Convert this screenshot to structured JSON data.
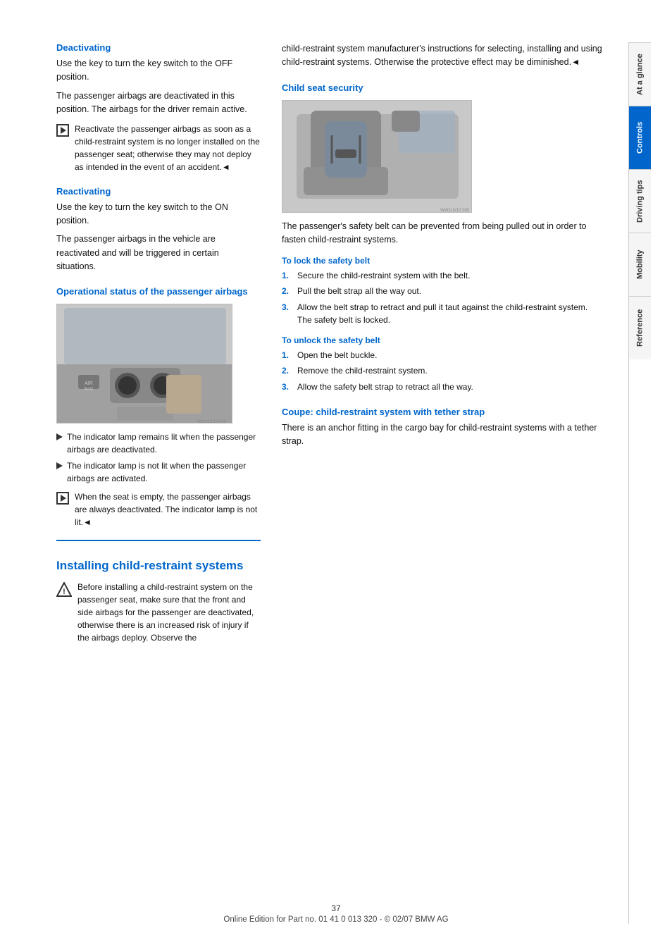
{
  "page": {
    "number": "37",
    "footer": "Online Edition for Part no. 01 41 0 013 320 - © 02/07 BMW AG"
  },
  "sidebar": {
    "tabs": [
      {
        "id": "at-a-glance",
        "label": "At a glance",
        "active": false
      },
      {
        "id": "controls",
        "label": "Controls",
        "active": true
      },
      {
        "id": "driving-tips",
        "label": "Driving tips",
        "active": false
      },
      {
        "id": "mobility",
        "label": "Mobility",
        "active": false
      },
      {
        "id": "reference",
        "label": "Reference",
        "active": false
      }
    ]
  },
  "left_column": {
    "deactivating": {
      "heading": "Deactivating",
      "para1": "Use the key to turn the key switch to the OFF position.",
      "para2": "The passenger airbags are deactivated in this position. The airbags for the driver remain active.",
      "note1": "Reactivate the passenger airbags as soon as a child-restraint system is no longer installed on the passenger seat; otherwise they may not deploy as intended in the event of an accident.◄"
    },
    "reactivating": {
      "heading": "Reactivating",
      "para1": "Use the key to turn the key switch to the ON position.",
      "para2": "The passenger airbags in the vehicle are reactivated and will be triggered in certain situations."
    },
    "operational_status": {
      "heading": "Operational status of the passenger airbags",
      "bullet1": "The indicator lamp remains lit when the passenger airbags are deactivated.",
      "bullet2": "The indicator lamp is not lit when the passenger airbags are activated.",
      "note1": "When the seat is empty, the passenger airbags are always deactivated. The indicator lamp is not lit.◄"
    },
    "installing": {
      "heading": "Installing child-restraint systems",
      "warning": "Before installing a child-restraint system on the passenger seat, make sure that the front and side airbags for the passenger are deactivated, otherwise there is an increased risk of injury if the airbags deploy. Observe the"
    }
  },
  "right_column": {
    "continued_text": "child-restraint system manufacturer's instructions for selecting, installing and using child-restraint systems. Otherwise the protective effect may be diminished.◄",
    "child_seat_security": {
      "heading": "Child seat security",
      "para1": "The passenger's safety belt can be prevented from being pulled out in order to fasten child-restraint systems."
    },
    "to_lock": {
      "heading": "To lock the safety belt",
      "steps": [
        {
          "num": "1.",
          "text": "Secure the child-restraint system with the belt."
        },
        {
          "num": "2.",
          "text": "Pull the belt strap all the way out."
        },
        {
          "num": "3.",
          "text": "Allow the belt strap to retract and pull it taut against the child-restraint system.\nThe safety belt is locked."
        }
      ]
    },
    "to_unlock": {
      "heading": "To unlock the safety belt",
      "steps": [
        {
          "num": "1.",
          "text": "Open the belt buckle."
        },
        {
          "num": "2.",
          "text": "Remove the child-restraint system."
        },
        {
          "num": "3.",
          "text": "Allow the safety belt strap to retract all the way."
        }
      ]
    },
    "coupe": {
      "heading": "Coupe: child-restraint system with tether strap",
      "para1": "There is an anchor fitting in the cargo bay for child-restraint systems with a tether strap."
    }
  }
}
